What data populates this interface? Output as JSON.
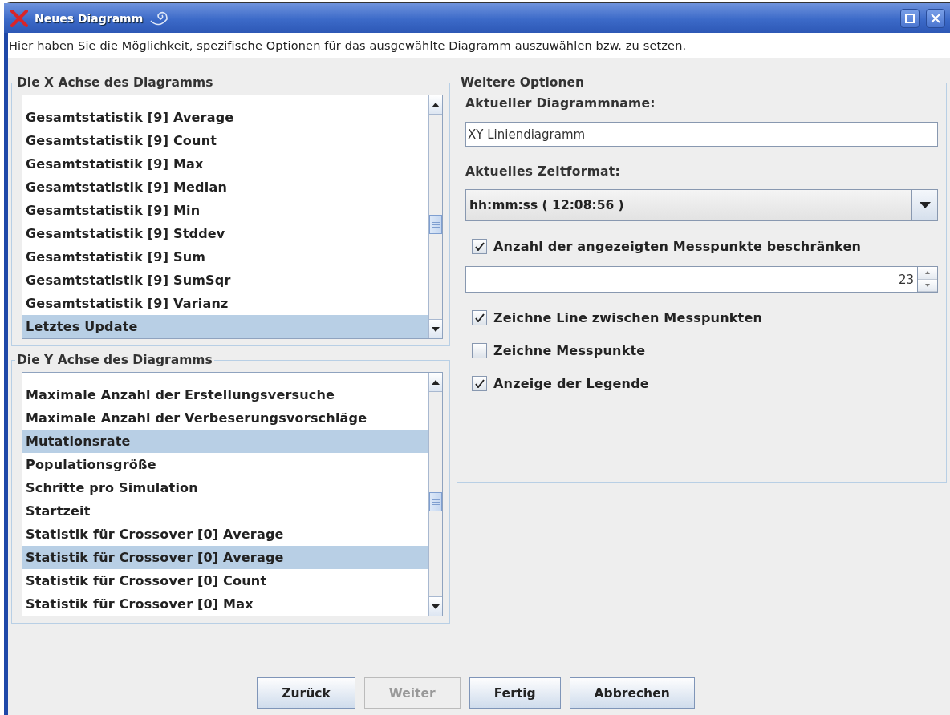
{
  "window": {
    "title": "Neues Diagramm"
  },
  "description": "Hier haben Sie die Möglichkeit, spezifische Optionen für das ausgewählte Diagramm auszuwählen bzw. zu setzen.",
  "x_axis": {
    "title": "Die X Achse des Diagramms",
    "items": [
      {
        "label": "Gesamtstatistik [9] Average",
        "selected": false
      },
      {
        "label": "Gesamtstatistik [9] Count",
        "selected": false
      },
      {
        "label": "Gesamtstatistik [9] Max",
        "selected": false
      },
      {
        "label": "Gesamtstatistik [9] Median",
        "selected": false
      },
      {
        "label": "Gesamtstatistik [9] Min",
        "selected": false
      },
      {
        "label": "Gesamtstatistik [9] Stddev",
        "selected": false
      },
      {
        "label": "Gesamtstatistik [9] Sum",
        "selected": false
      },
      {
        "label": "Gesamtstatistik [9] SumSqr",
        "selected": false
      },
      {
        "label": "Gesamtstatistik [9] Varianz",
        "selected": false
      },
      {
        "label": "Letztes Update",
        "selected": true
      }
    ]
  },
  "y_axis": {
    "title": "Die Y Achse des Diagramms",
    "items": [
      {
        "label": "Maximale Anzahl der Erstellungsversuche",
        "selected": false
      },
      {
        "label": "Maximale Anzahl der Verbeserungsvorschläge",
        "selected": false
      },
      {
        "label": "Mutationsrate",
        "selected": true
      },
      {
        "label": "Populationsgröße",
        "selected": false
      },
      {
        "label": "Schritte pro Simulation",
        "selected": false
      },
      {
        "label": "Startzeit",
        "selected": false
      },
      {
        "label": "Statistik für Crossover [0] Average",
        "selected": false
      },
      {
        "label": "Statistik für Crossover [0] Average",
        "selected": true
      },
      {
        "label": "Statistik für Crossover [0] Count",
        "selected": false
      },
      {
        "label": "Statistik für Crossover [0] Max",
        "selected": false
      }
    ]
  },
  "options": {
    "title": "Weitere Optionen",
    "name_label": "Aktueller Diagrammname:",
    "name_value": "XY Liniendiagramm",
    "format_label": "Aktuelles Zeitformat:",
    "format_value": "hh:mm:ss ( 12:08:56 )",
    "items": [
      {
        "kind": "checkbox",
        "label": "Anzahl der angezeigten Messpunkte beschränken",
        "checked": true
      },
      {
        "kind": "spinner",
        "value": "23"
      },
      {
        "kind": "checkbox",
        "label": "Zeichne Line zwischen Messpunkten",
        "checked": true
      },
      {
        "kind": "checkbox",
        "label": "Zeichne Messpunkte",
        "checked": false
      },
      {
        "kind": "checkbox",
        "label": "Anzeige der Legende",
        "checked": true
      }
    ]
  },
  "buttons": [
    {
      "label": "Zurück",
      "disabled": false
    },
    {
      "label": "Weiter",
      "disabled": true
    },
    {
      "label": "Fertig",
      "disabled": false
    },
    {
      "label": "Abbrechen",
      "disabled": false
    }
  ]
}
